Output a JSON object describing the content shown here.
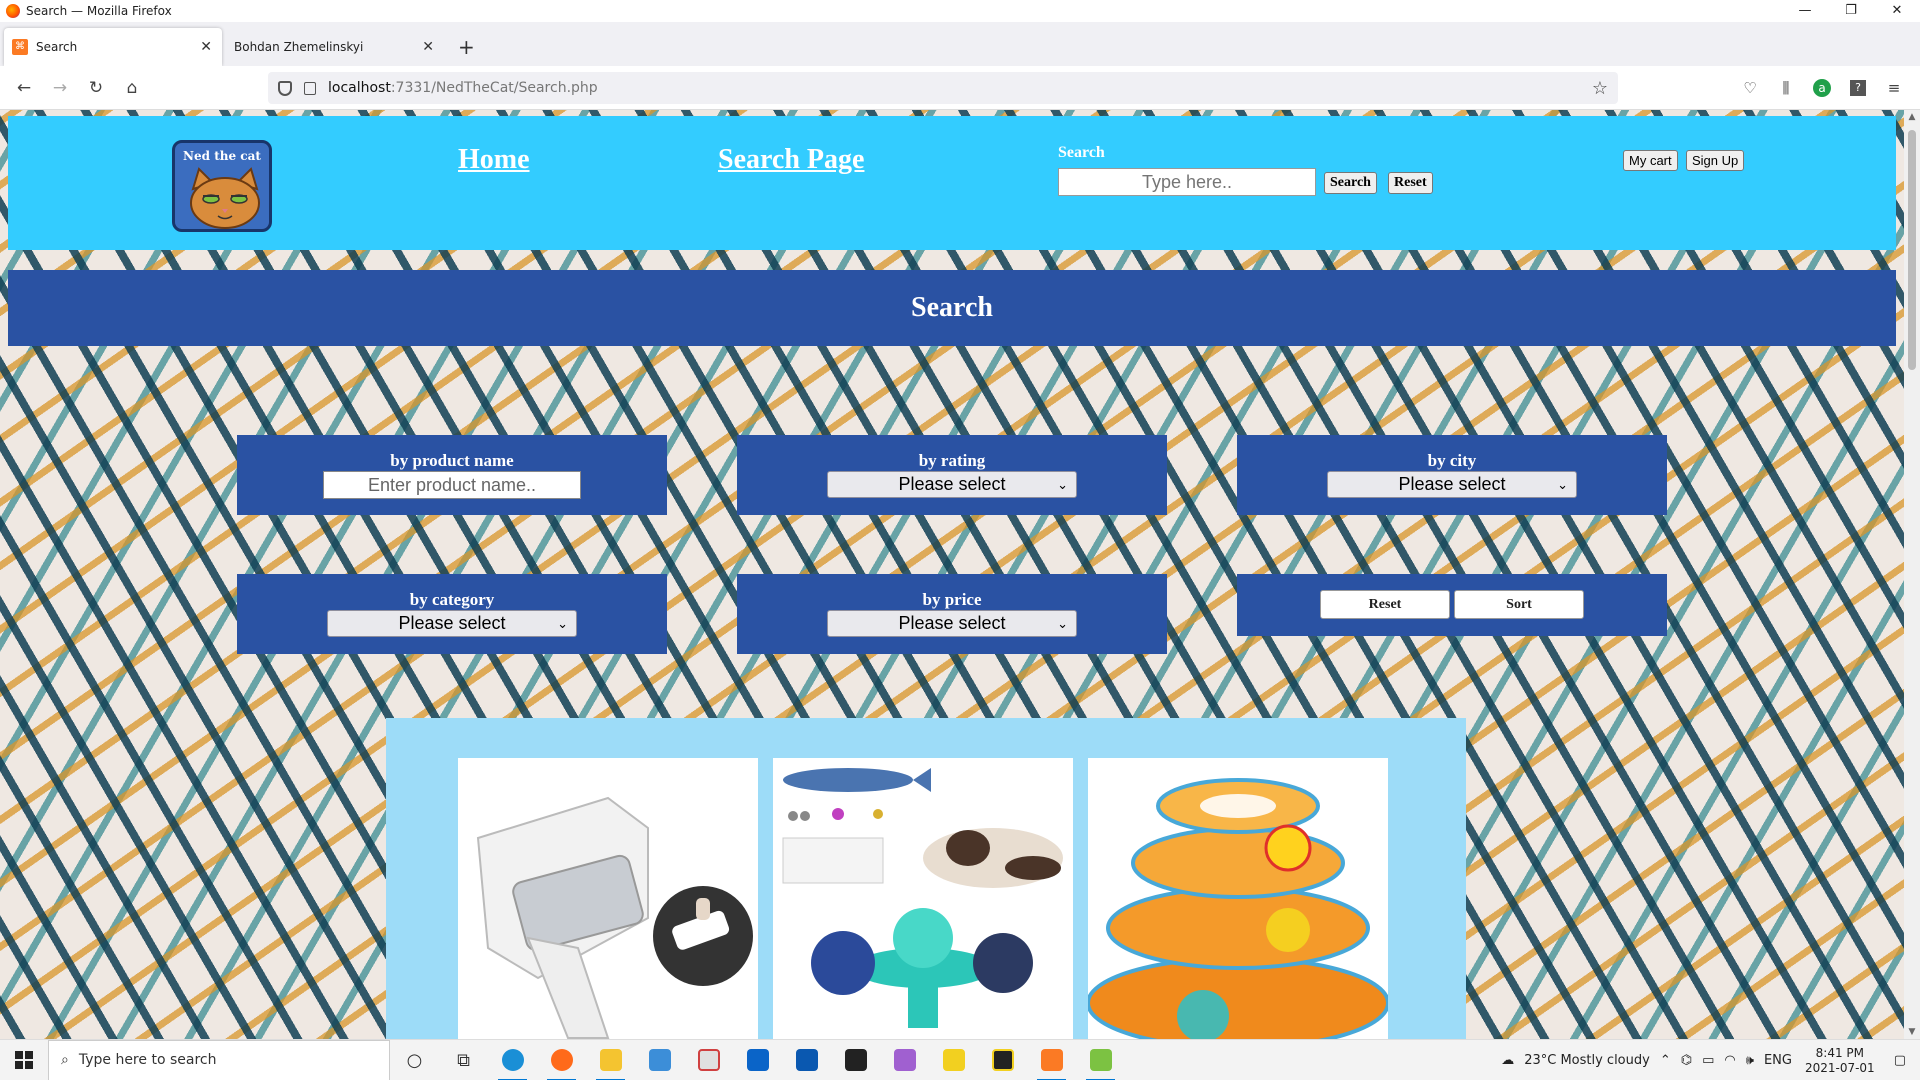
{
  "window": {
    "title": "Search — Mozilla Firefox",
    "controls": [
      "—",
      "❐",
      "✕"
    ]
  },
  "tabs": [
    {
      "label": "Search",
      "active": true
    },
    {
      "label": "Bohdan Zhemelinskyi",
      "active": false
    }
  ],
  "url": {
    "host": "localhost",
    "path": ":7331/NedTheCat/Search.php"
  },
  "site": {
    "logo_text": "Ned the cat",
    "nav": {
      "home": "Home",
      "search_page": "Search Page"
    },
    "search": {
      "label": "Search",
      "placeholder": "Type here..",
      "search_button": "Search",
      "reset_button": "Reset"
    },
    "cart_button": "My cart",
    "signup_button": "Sign Up",
    "page_heading": "Search"
  },
  "filters": {
    "product_name": {
      "label": "by product name",
      "placeholder": "Enter product name.."
    },
    "rating": {
      "label": "by rating",
      "selected": "Please select"
    },
    "city": {
      "label": "by city",
      "selected": "Please select"
    },
    "category": {
      "label": "by category",
      "selected": "Please select"
    },
    "price": {
      "label": "by price",
      "selected": "Please select"
    },
    "reset_button": "Reset",
    "sort_button": "Sort"
  },
  "products": [
    {
      "image": "pet-hair-roller"
    },
    {
      "image": "cat-toys-fish-spinner"
    },
    {
      "image": "cat-ball-track-tower"
    }
  ],
  "taskbar": {
    "search_placeholder": "Type here to search",
    "weather": "23°C  Mostly cloudy",
    "language": "ENG",
    "time": "8:41 PM",
    "date": "2021-07-01"
  },
  "colors": {
    "header": "#33ccff",
    "banner": "#2a52a3",
    "products_bg": "#9ddcf8"
  }
}
